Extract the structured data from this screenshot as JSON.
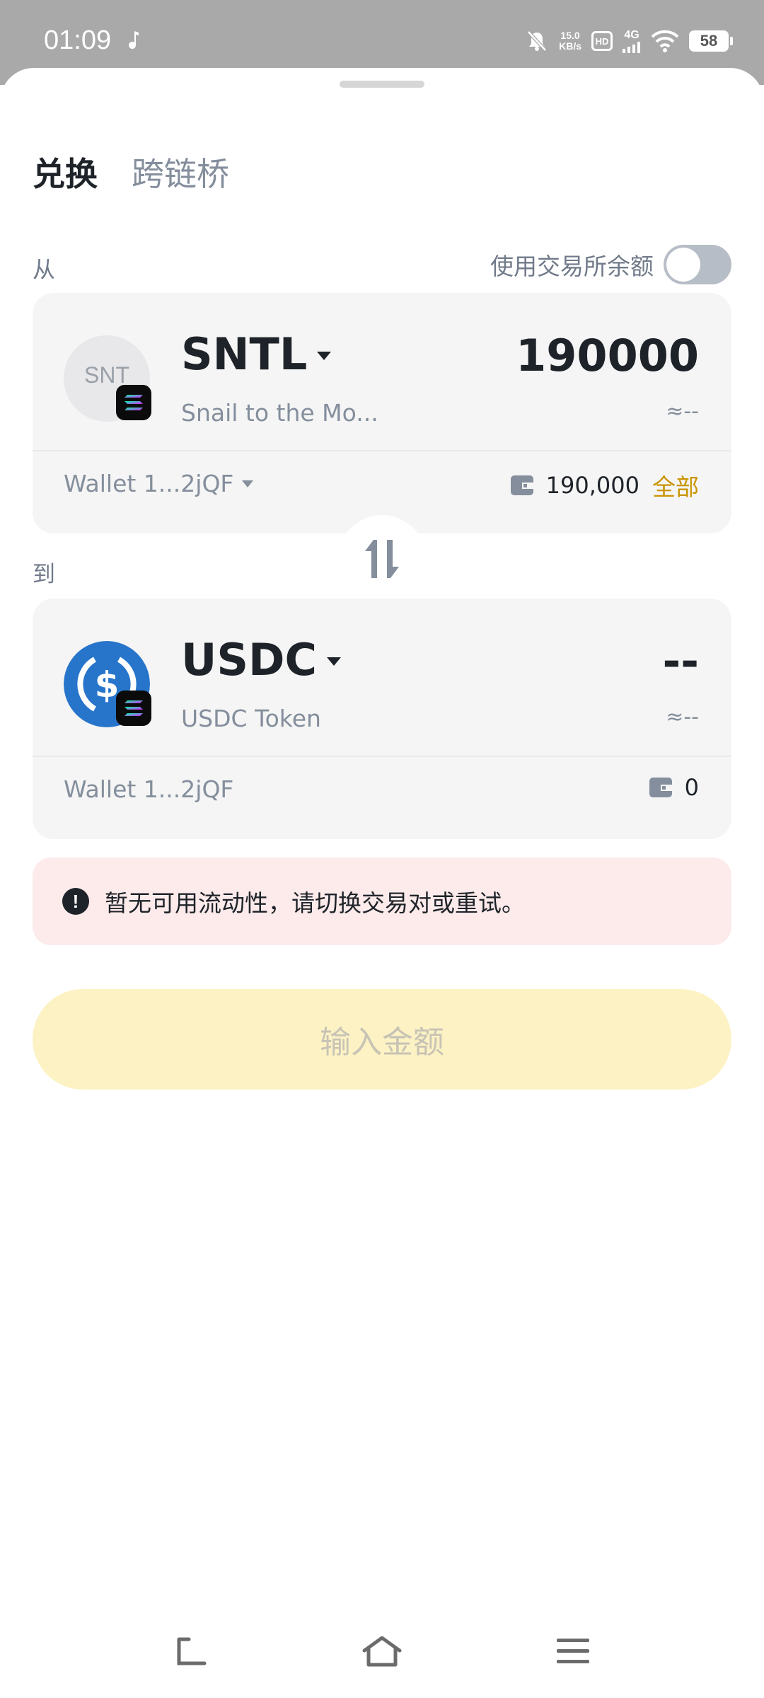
{
  "status_bar": {
    "time": "01:09",
    "net_speed_value": "15.0",
    "net_speed_unit": "KB/s",
    "hd": "HD",
    "signal": "4G",
    "battery": "58"
  },
  "tabs": [
    {
      "label": "兑换",
      "active": true
    },
    {
      "label": "跨链桥",
      "active": false
    }
  ],
  "from_section": {
    "label": "从",
    "use_exchange_balance_label": "使用交易所余额",
    "use_exchange_balance_on": false,
    "token": {
      "icon_text": "SNT",
      "symbol": "SNTL",
      "name": "Snail to the Mo...",
      "amount": "190000",
      "approx_value": "≈--"
    },
    "wallet": "Wallet 1...2jQF",
    "balance": "190,000",
    "max_label": "全部"
  },
  "to_section": {
    "label": "到",
    "token": {
      "symbol": "USDC",
      "name": "USDC Token",
      "amount": "--",
      "approx_value": "≈--"
    },
    "wallet": "Wallet 1...2jQF",
    "balance": "0"
  },
  "alert": {
    "message": "暂无可用流动性，请切换交易对或重试。"
  },
  "cta": {
    "label": "输入金额"
  },
  "colors": {
    "accent": "#c99400",
    "usdc_blue": "#2775ca",
    "alert_bg": "#fdebeb",
    "cta_bg": "#fdf2c4"
  }
}
